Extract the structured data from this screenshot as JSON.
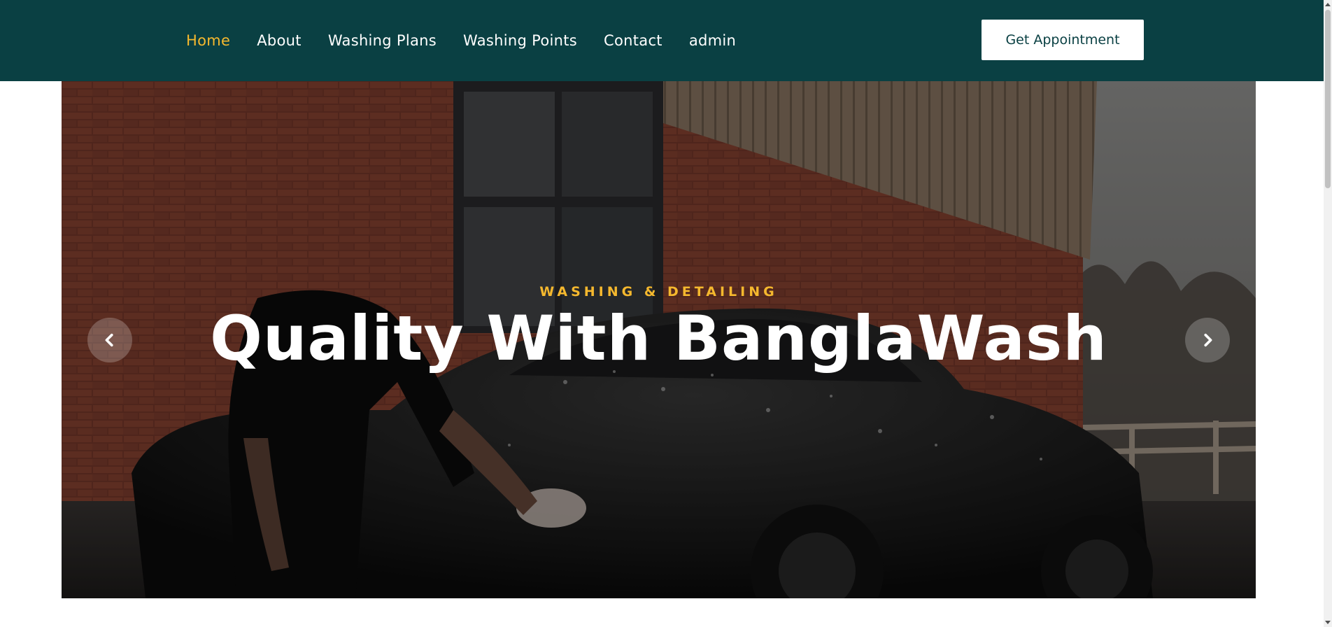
{
  "nav": {
    "items": [
      {
        "label": "Home",
        "active": true
      },
      {
        "label": "About",
        "active": false
      },
      {
        "label": "Washing Plans",
        "active": false
      },
      {
        "label": "Washing Points",
        "active": false
      },
      {
        "label": "Contact",
        "active": false
      },
      {
        "label": "admin",
        "active": false
      }
    ],
    "cta_label": "Get Appointment"
  },
  "hero": {
    "kicker": "WASHING & DETAILING",
    "title": "Quality With BanglaWash",
    "prev_icon": "chevron-left-icon",
    "next_icon": "chevron-right-icon"
  },
  "colors": {
    "header_bg": "#0a4043",
    "accent": "#f5b82e",
    "cta_bg": "#ffffff",
    "cta_text": "#0a4043"
  }
}
